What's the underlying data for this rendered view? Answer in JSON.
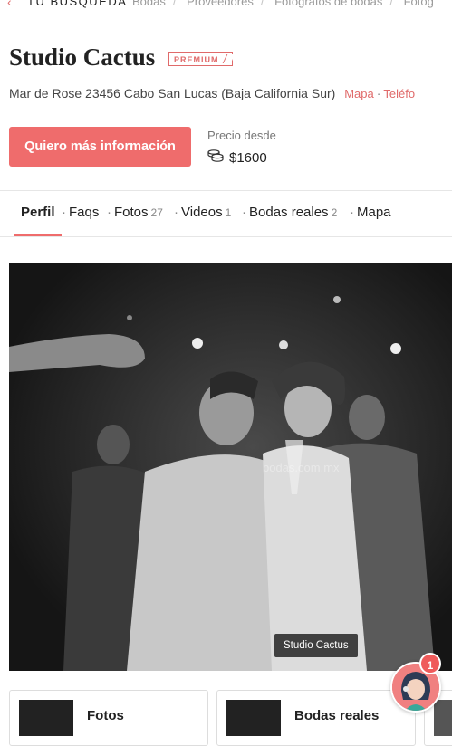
{
  "topbar": {
    "back_label": "TU BÚSQUEDA",
    "breadcrumbs": [
      "Bodas",
      "Proveedores",
      "Fotógrafos de bodas",
      "Fotóg"
    ]
  },
  "vendor": {
    "name": "Studio Cactus",
    "badge": "PREMIUM",
    "address": "Mar de Rose 23456 Cabo San Lucas (Baja California Sur)",
    "map_link": "Mapa",
    "phone_link": "Teléfo"
  },
  "cta": {
    "label": "Quiero más información"
  },
  "price": {
    "label": "Precio desde",
    "value": "$1600"
  },
  "tabs": [
    {
      "label": "Perfil",
      "count": ""
    },
    {
      "label": "Faqs",
      "count": ""
    },
    {
      "label": "Fotos",
      "count": "27"
    },
    {
      "label": "Videos",
      "count": "1"
    },
    {
      "label": "Bodas reales",
      "count": "2"
    },
    {
      "label": "Mapa",
      "count": ""
    }
  ],
  "photo": {
    "caption": "Studio Cactus",
    "watermark": "bodas.com.mx"
  },
  "cards": [
    {
      "label": "Fotos"
    },
    {
      "label": "Bodas reales"
    }
  ],
  "chat": {
    "badge_count": "1"
  },
  "colors": {
    "accent": "#ef6c6c"
  }
}
